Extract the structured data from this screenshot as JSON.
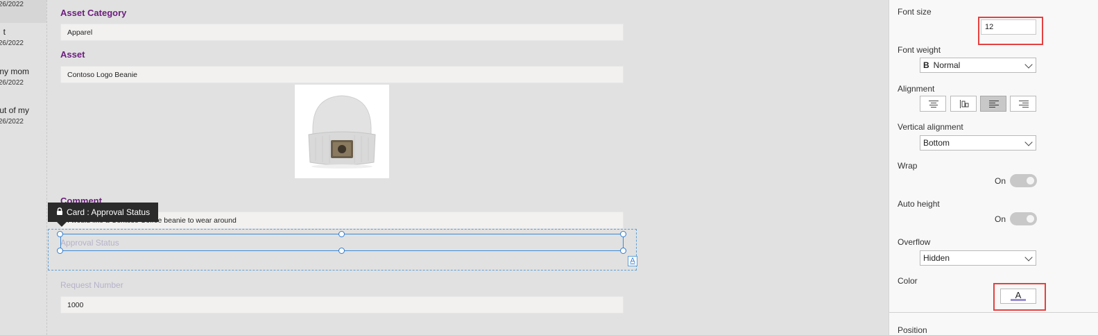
{
  "gallery": {
    "items": [
      {
        "title": "",
        "date": "26/2022"
      },
      {
        "title": "t",
        "date": "26/2022"
      },
      {
        "title": "ny mom",
        "date": "26/2022"
      },
      {
        "title": "out of my",
        "date": "26/2022"
      }
    ]
  },
  "form": {
    "asset_category_label": "Asset Category",
    "asset_category_value": "Apparel",
    "asset_label": "Asset",
    "asset_value": "Contoso Logo Beanie",
    "comment_label": "Comment",
    "comment_value": "I would like a Contoso Coffee beanie to wear around",
    "approval_status_label": "Approval Status",
    "request_number_label": "Request Number",
    "request_number_value": "1000",
    "image_icon": "beanie-image"
  },
  "tooltip": {
    "text": "Card : Approval Status",
    "icon": "lock-icon"
  },
  "selection": {
    "badge_text": "A"
  },
  "properties": {
    "font_size_label": "Font size",
    "font_size_value": "12",
    "font_weight_label": "Font weight",
    "font_weight_prefix": "B",
    "font_weight_value": "Normal",
    "alignment_label": "Alignment",
    "alignment_options": [
      "center",
      "justify",
      "left",
      "right"
    ],
    "alignment_selected": "left",
    "vertical_alignment_label": "Vertical alignment",
    "vertical_alignment_value": "Bottom",
    "wrap_label": "Wrap",
    "wrap_state": "On",
    "auto_height_label": "Auto height",
    "auto_height_state": "On",
    "overflow_label": "Overflow",
    "overflow_value": "Hidden",
    "color_label": "Color",
    "color_glyph": "A",
    "color_value": "#9a8ed1",
    "position_label": "Position"
  },
  "colors": {
    "label_purple": "#6b1d7d",
    "highlight_red": "#e5403f",
    "selection_blue": "#3a8ad6"
  }
}
